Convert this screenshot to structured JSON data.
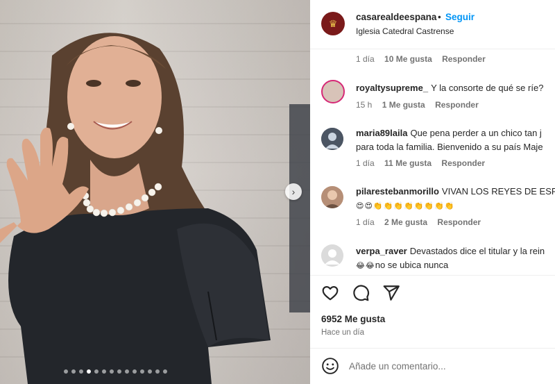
{
  "post": {
    "username": "casarealdeespana",
    "separator": "•",
    "follow_label": "Seguir",
    "location": "Iglesia Catedral Castrense"
  },
  "caption_meta": {
    "time": "1 día",
    "likes": "10 Me gusta",
    "reply": "Responder"
  },
  "comments": [
    {
      "user": "royaltysupreme_",
      "text": "Y la consorte de qué se ríe?",
      "time": "15 h",
      "likes": "1 Me gusta",
      "reply": "Responder"
    },
    {
      "user": "maria89laila",
      "text": "Que pena perder a un chico tan j",
      "text2": "para toda la familia. Bienvenido a su país Maje",
      "time": "1 día",
      "likes": "11 Me gusta",
      "reply": "Responder"
    },
    {
      "user": "pilaresteban morillo",
      "display_user": "pilarestebanmorillo",
      "text": "VIVAN LOS REYES DE ESPA",
      "emojis": "😍😍👏👏👏👏👏👏👏👏",
      "time": "1 día",
      "likes": "2 Me gusta",
      "reply": "Responder"
    },
    {
      "user": "verpa_raver",
      "text": "Devastados dice el titular y la rein",
      "text2": "no se ubica nunca",
      "emojis2": "😂😂"
    }
  ],
  "likes_total": "6952 Me gusta",
  "posted_ago": "Hace un día",
  "add_comment": {
    "placeholder": "Añade un comentario..."
  },
  "carousel": {
    "slides": 14,
    "active_index": 3
  },
  "icons": {
    "like": "heart-icon",
    "comment": "comment-bubble-icon",
    "share": "paper-plane-icon",
    "emoji": "smiley-icon",
    "next": "chevron-right-icon"
  },
  "colors": {
    "follow": "#0095f6",
    "meta": "#737373",
    "text": "#262626"
  }
}
